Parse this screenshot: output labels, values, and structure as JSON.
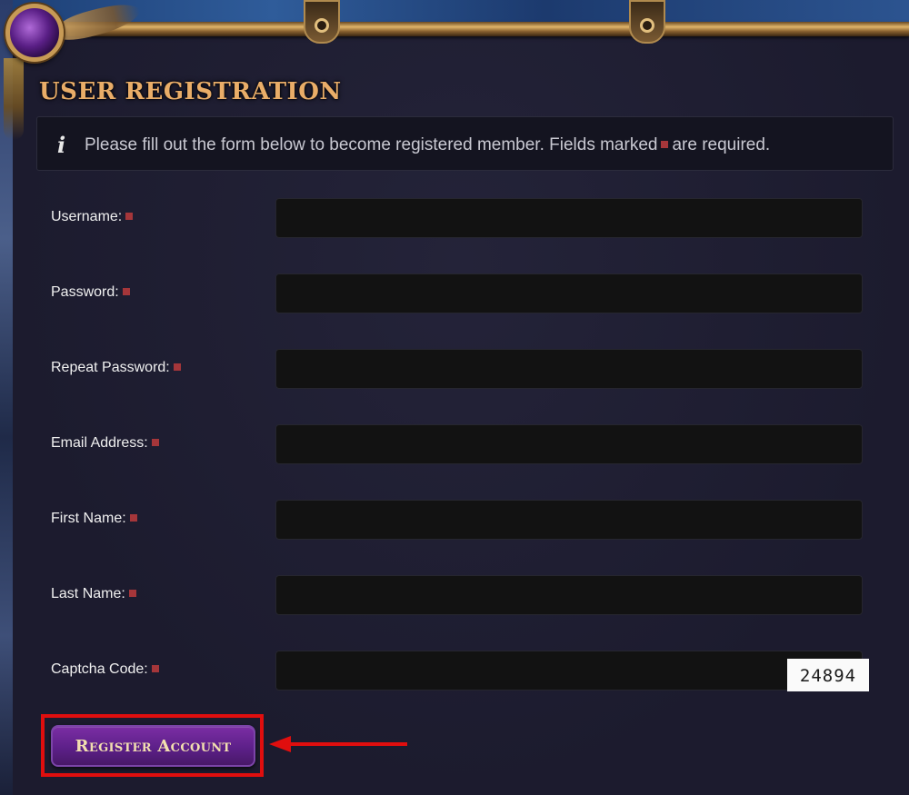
{
  "page": {
    "title": "USER REGISTRATION",
    "info_icon": "info-icon",
    "info_text_before": "Please fill out the form below to become registered member. Fields marked",
    "info_text_after": "are required."
  },
  "form": {
    "fields": [
      {
        "label": "Username:",
        "value": "",
        "required": true
      },
      {
        "label": "Password:",
        "value": "",
        "required": true
      },
      {
        "label": "Repeat Password:",
        "value": "",
        "required": true
      },
      {
        "label": "Email Address:",
        "value": "",
        "required": true
      },
      {
        "label": "First Name:",
        "value": "",
        "required": true
      },
      {
        "label": "Last Name:",
        "value": "",
        "required": true
      },
      {
        "label": "Captcha Code:",
        "value": "",
        "required": true
      }
    ],
    "captcha_code": "24894",
    "submit_label": "Register Account"
  },
  "colors": {
    "accent_title": "#e9ad68",
    "required_marker": "#a5363a",
    "button_purple": "#5d2089",
    "annotation_red": "#e00e0e"
  }
}
